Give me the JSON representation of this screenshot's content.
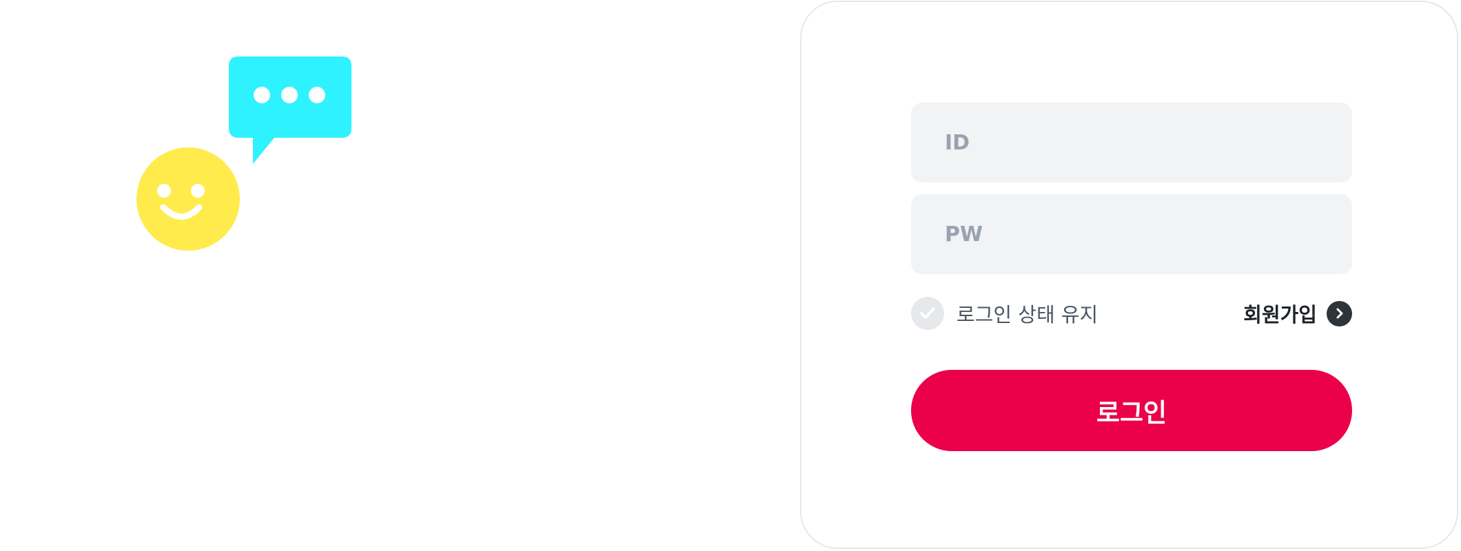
{
  "login_form": {
    "id_placeholder": "ID",
    "pw_placeholder": "PW",
    "keep_login_label": "로그인 상태 유지",
    "keep_login_checked": false,
    "signup_label": "회원가입",
    "login_button_label": "로그인"
  },
  "icons": {
    "illustration": [
      "speech-bubble-icon",
      "smiley-face-icon"
    ],
    "keep_login": "checkmark-icon",
    "signup": "chevron-right-icon"
  },
  "colors": {
    "primary": "#eb004a",
    "speech_bubble": "#2ef2ff",
    "smiley": "#ffec4c",
    "field_background": "#f1f3f5",
    "placeholder": "#9aa2af",
    "card_border": "#e5e7eb",
    "dark_icon": "#2f3438"
  }
}
